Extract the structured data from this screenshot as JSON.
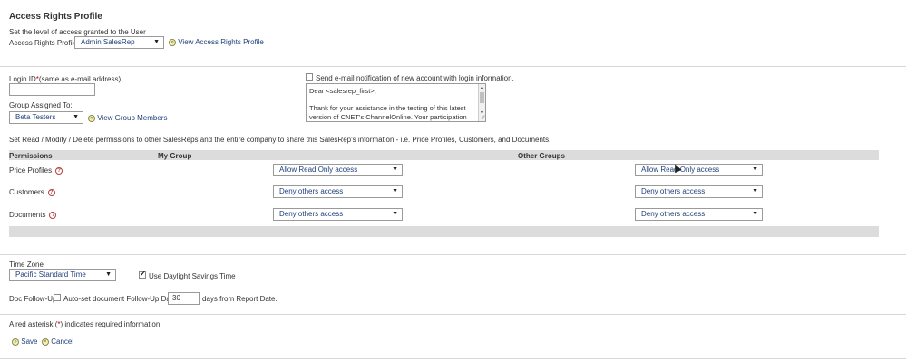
{
  "access_profile": {
    "title": "Access Rights Profile",
    "description": "Set the level of access granted to the User",
    "label": "Access Rights Profile:",
    "selected": "Admin SalesRep",
    "view_link": "View Access Rights Profile"
  },
  "login": {
    "label": "Login ID",
    "asterisk": "*",
    "hint": "(same as e-mail address)",
    "value": ""
  },
  "group": {
    "label": "Group Assigned To:",
    "selected": "Beta Testers",
    "view_link": "View Group Members"
  },
  "notification": {
    "checkbox_label": "Send e-mail notification of new account with login information.",
    "checked": false,
    "body": "Dear <salesrep_first>,\n\nThank for your assistance in the testing of this latest version of CNET's ChannelOnline.  Your participation"
  },
  "permissions": {
    "intro": "Set Read / Modify / Delete permissions to other SalesReps and the entire company to share this SalesRep's information - i.e. Price Profiles, Customers, and Documents.",
    "headers": {
      "permissions": "Permissions",
      "my_group": "My Group",
      "other_groups": "Other Groups"
    },
    "rows": [
      {
        "label": "Price Profiles",
        "my_group": "Allow Read Only access",
        "other_groups": "Allow Read Only access"
      },
      {
        "label": "Customers",
        "my_group": "Deny others access",
        "other_groups": "Deny others access"
      },
      {
        "label": "Documents",
        "my_group": "Deny others access",
        "other_groups": "Deny others access"
      }
    ]
  },
  "timezone": {
    "label": "Time Zone",
    "selected": "Pacific Standard Time",
    "dst_label": "Use Daylight Savings Time",
    "dst_checked": true
  },
  "followup": {
    "label": "Doc Follow-Up",
    "checkbox_label": "Auto-set document Follow-Up Date",
    "checked": false,
    "days": "30",
    "suffix": "days from Report Date."
  },
  "footer": {
    "note_prefix": "A red asterisk (",
    "note_asterisk": "*",
    "note_suffix": ") indicates required information.",
    "save": "Save",
    "cancel": "Cancel"
  },
  "icons": {
    "help": "?",
    "go": "»",
    "cancel": "×",
    "dropdown": "▼"
  },
  "colors": {
    "link": "#1f3f7a",
    "asterisk": "#c00000",
    "header_bar": "#dcdcdc"
  }
}
